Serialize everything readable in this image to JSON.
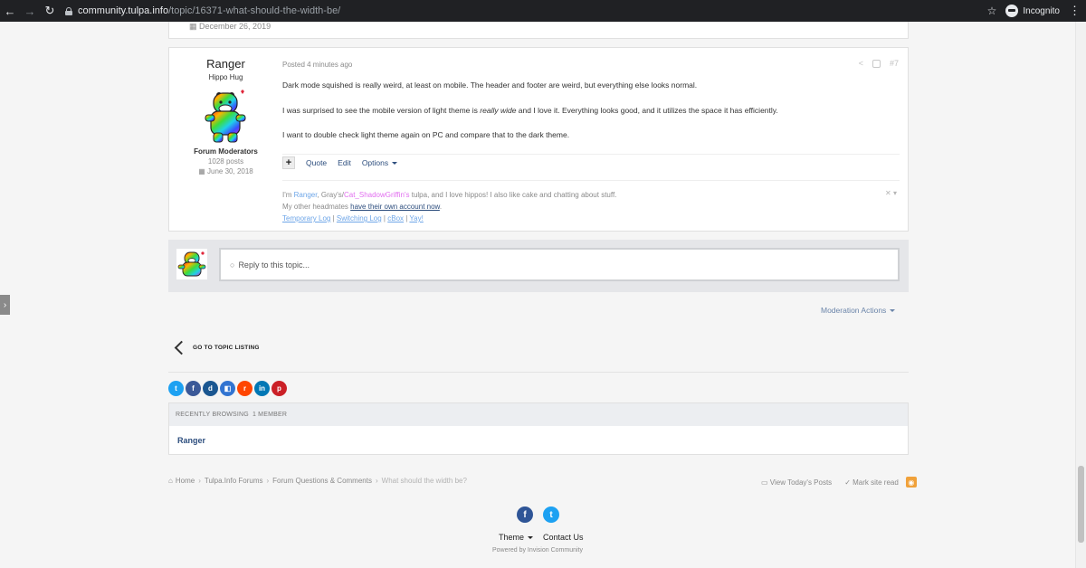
{
  "browser": {
    "url_host": "community.tulpa.info",
    "url_path": "/topic/16371-what-should-the-width-be/",
    "incognito_label": "Incognito"
  },
  "prev_post": {
    "date": "December 26, 2019"
  },
  "post": {
    "author": {
      "name": "Ranger",
      "title": "Hippo Hug",
      "group": "Forum Moderators",
      "posts": "1028 posts",
      "joined": "June 30, 2018"
    },
    "posted": "Posted 4 minutes ago",
    "paragraphs": {
      "p1": "Dark mode squished is really weird, at least on mobile. The header and footer are weird, but everything else looks normal.",
      "p2_a": "I was surprised to see the mobile version of light theme is ",
      "p2_em": "really wide",
      "p2_b": " and I love it. Everything looks good, and it utilizes the space it has efficiently.",
      "p3": "I want to double check light theme again on PC and compare that to the dark theme."
    },
    "controls": {
      "plus": "+",
      "quote": "Quote",
      "edit": "Edit",
      "options": "Options"
    },
    "signature": {
      "s1_pre": "I'm ",
      "s1_name": "Ranger",
      "s1_mid": ", Gray's/",
      "s1_pink": "Cat_ShadowGriffin's",
      "s1_post": " tulpa, and I love hippos! I also like cake and chatting about stuff.",
      "s2_pre": "My other headmates ",
      "s2_link": "have their own account now",
      "s2_post": ".",
      "links": [
        "Temporary Log",
        "Switching Log",
        "cBox",
        "Yay!"
      ],
      "link_sep": " | "
    }
  },
  "reply": {
    "placeholder": "Reply to this topic..."
  },
  "moderation_actions": "Moderation Actions",
  "go_to_topic_listing": "GO TO TOPIC LISTING",
  "share_buttons": [
    {
      "name": "twitter",
      "color": "#1da1f2",
      "glyph": "t"
    },
    {
      "name": "facebook",
      "color": "#3b5998",
      "glyph": "f"
    },
    {
      "name": "digg",
      "color": "#1b5791",
      "glyph": "d"
    },
    {
      "name": "delicious",
      "color": "#3274d1",
      "glyph": "◧"
    },
    {
      "name": "reddit",
      "color": "#ff4500",
      "glyph": "r"
    },
    {
      "name": "linkedin",
      "color": "#0077b5",
      "glyph": "in"
    },
    {
      "name": "pinterest",
      "color": "#cb2027",
      "glyph": "p"
    }
  ],
  "recently_browsing": {
    "title": "RECENTLY BROWSING",
    "count": "1 MEMBER",
    "member": "Ranger"
  },
  "breadcrumb": {
    "items": [
      "Home",
      "Tulpa.Info Forums",
      "Forum Questions & Comments"
    ],
    "current": "What should the width be?"
  },
  "footer_links": {
    "view_todays_posts": "View Today's Posts",
    "mark_site_read": "Mark site read"
  },
  "footer": {
    "theme": "Theme",
    "contact": "Contact Us",
    "powered": "Powered by Invision Community"
  }
}
